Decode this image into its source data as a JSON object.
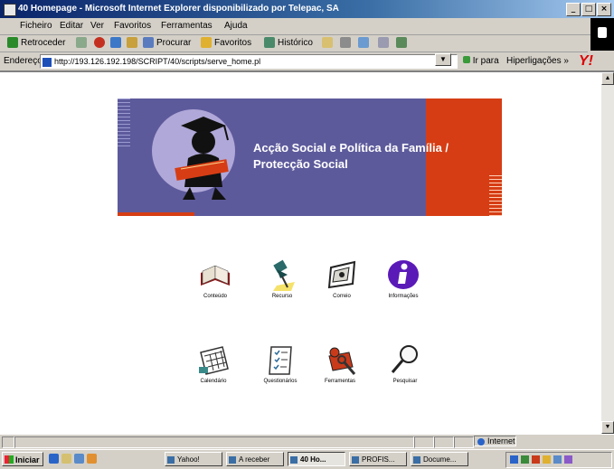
{
  "window": {
    "title": "40 Homepage - Microsoft Internet Explorer disponibilizado por Telepac, SA",
    "buttons": [
      "_",
      "□",
      "×"
    ]
  },
  "menu": [
    "Ficheiro",
    "Editar",
    "Ver",
    "Favoritos",
    "Ferramentas",
    "Ajuda"
  ],
  "toolbar": {
    "back": "Retroceder",
    "search": "Procurar",
    "favorites": "Favoritos",
    "history": "Histórico"
  },
  "address": {
    "label": "Endereço",
    "url": "http://193.126.192.198/SCRIPT/40/scripts/serve_home.pl",
    "go": "Ir para",
    "links": "Hiperligações",
    "links_more": "»"
  },
  "banner": {
    "title_line1": "Acção Social e Política da Família /",
    "title_line2": "Protecção Social"
  },
  "apps": [
    {
      "label": "Conteúdo",
      "icon": "book-icon"
    },
    {
      "label": "Recurso",
      "icon": "pushpin-icon"
    },
    {
      "label": "Correio",
      "icon": "mail-icon"
    },
    {
      "label": "Informações",
      "icon": "info-icon"
    },
    {
      "label": "Calendário",
      "icon": "calendar-icon"
    },
    {
      "label": "Questionários",
      "icon": "checklist-icon"
    },
    {
      "label": "Ferramentas",
      "icon": "toolbox-icon"
    },
    {
      "label": "Pesquisar",
      "icon": "magnifier-icon"
    }
  ],
  "status": {
    "zone": "Internet"
  },
  "taskbar": {
    "start": "Iniciar",
    "tasks": [
      "Yahoo!",
      "A receber",
      "40 Ho...",
      "PROFIS...",
      "Docume..."
    ]
  }
}
